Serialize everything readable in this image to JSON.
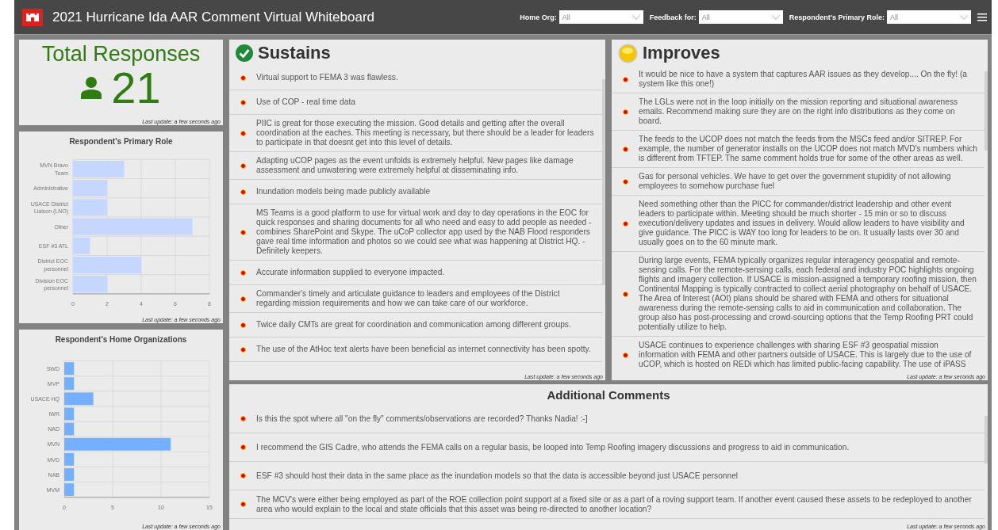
{
  "header": {
    "title": "2021 Hurricane Ida AAR Comment Virtual Whiteboard",
    "filters": [
      {
        "label": "Home Org:",
        "value": "All"
      },
      {
        "label": "Feedback for:",
        "value": "All"
      },
      {
        "label": "Respondent's Primary Role:",
        "value": "All"
      }
    ]
  },
  "total_responses": {
    "title": "Total Responses",
    "value": "21",
    "last_update": "Last update: a few seconds ago"
  },
  "charts": [
    {
      "title": "Respondent's Primary Role",
      "last_update": "Last update: a few seconds ago",
      "chart_data": {
        "type": "bar",
        "orientation": "horizontal",
        "categories": [
          "MVN Bravo Team",
          "Administrative",
          "USACE District Liaison (LNO)",
          "Other",
          "ESF #3 ATL",
          "District EOC personnel",
          "Division EOC personnel"
        ],
        "grid": true,
        "series": [
          {
            "color": "#c5d6ff",
            "values": [
              3,
              2,
              2,
              7,
              1,
              4,
              2
            ]
          }
        ],
        "xlim": [
          0,
          8
        ],
        "xticks": [
          0,
          2,
          4,
          6,
          8
        ]
      }
    },
    {
      "title": "Respondent's Home Organizations",
      "last_update": "Last update: a few seconds ago",
      "chart_data": {
        "type": "bar",
        "orientation": "horizontal",
        "categories": [
          "SWD",
          "MVP",
          "USACE HQ",
          "IWR",
          "NAD",
          "MVN",
          "MVD",
          "NAB",
          "MVM"
        ],
        "grid": true,
        "series": [
          {
            "color": "#74b0ff",
            "values": [
              1,
              1,
              3,
              1,
              1,
              11,
              1,
              1,
              1
            ]
          }
        ],
        "xlim": [
          0,
          15
        ],
        "xticks": [
          0,
          5,
          10,
          15
        ]
      }
    }
  ],
  "sustains": {
    "title": "Sustains",
    "kind": "check",
    "last_update": "Last update: a few seconds ago",
    "items": [
      "Virtual support to FEMA 3 was flawless.",
      "Use of COP - real time data",
      "PIIC is great for those executing the mission. Good details and getting after the overall coordination at the eaches. This meeting is necessary, but there should be a leader for leaders to participate in that doesnt get into this level of details.",
      "Adapting uCOP pages as the event unfolds is extremely helpful. New pages like damage assessment and unwatering were extremely helpful at disseminating info.",
      "Inundation models being made publicly available",
      "MS Teams is a good platform to use for virtual work and day to day operations in the EOC for quick responses and sharing documents for all who need and easy to add people as needed - combines SharePoint and Skype. The uCoP collector app used by the NAB Flood responders gave real time information and photos so we could see what was happening at District HQ. - Definitely keepers.",
      "Accurate information supplied to everyone impacted.",
      "Commander's timely and articulate guidance to leaders and employees of the District regarding mission requirements and how we can take care of our workforce.",
      "Twice daily CMTs are great for coordination and communication among different groups.",
      "The use of the AtHoc text alerts have been beneficial as internet connectivity has been spotty."
    ]
  },
  "improves": {
    "title": "Improves",
    "kind": "sun",
    "last_update": "Last update: a few seconds ago",
    "items": [
      "It would be nice to have a system that captures AAR issues as they develop.... On the fly! (a system like this one!)",
      "The LGLs were not in the loop initially on the mission reporting and situational awareness emails. Recommend making sure they are on the right info distributions as they come on board.",
      "The feeds to the UCOP does not match the feeds from the MSCs feed and/or SITREP. For example, the number of generator installs on the UCOP does not match MVD's numbers which is different from TFTEP. The same comment holds true for some of the other areas as well.",
      "Gas for personal vehicles. We have to get over the government stupidity of not allowing employees to somehow purchase fuel",
      "Need something other than the PICC for commander/district leadership and other event leaders to participate within. Meeting should be much shorter - 15 min or so to discuss execution/delivery updates and issues in delivery. Would allow leaders to have visibility and give guidance. The PICC is WAY too long for leaders to be on. It usually lasts over 30 and usually goes on to the 60 minute mark.",
      "During large events, FEMA typically organizes regular interagency geospatial and remote-sensing calls. For the remote-sensing calls, each federal and industry POC highlights ongoing flights and imagery collection. If USACE is mission-assigned a temporary roofing mission, then Continental Mapping is typically contracted to collect aerial photography on behalf of USACE. The Area of Interest (AOI) plans should be shared with FEMA and others for situational awareness during the remote-sensing calls to aid in communication and collaboration. The group also has post-processing and crowd-sourcing options that the Temp Roofing PRT could potentially utilize to help.",
      "USACE continues to experience challenges with sharing ESF #3 geospatial mission information with FEMA and other partners outside of USACE. This is largely due to the use of uCOP, which is hosted on REDi which has limited public-facing capability. The use of iPASS"
    ]
  },
  "additional_comments": {
    "title": "Additional Comments",
    "kind": "plain",
    "last_update": "Last update: a few seconds ago",
    "items": [
      "Is this the spot where all \"on the fly\" comments/observations are recorded? Thanks Nadia! :-]",
      "I recommend the GIS Cadre, who attends the FEMA calls on a regular basis, be looped into Temp Roofing imagery discussions and progress to aid in communication.",
      "ESF #3 should host their data in the same place as the inundation models so that the data is accessible beyond just USACE personnel",
      "The MCV's were either being employed as part of the ROE collection point support at a fixed site or as a part of a roving support team. If another event caused these assets to be redeployed to another area who would explain to the local and state officials that this asset was being re-directed to another location?"
    ]
  }
}
